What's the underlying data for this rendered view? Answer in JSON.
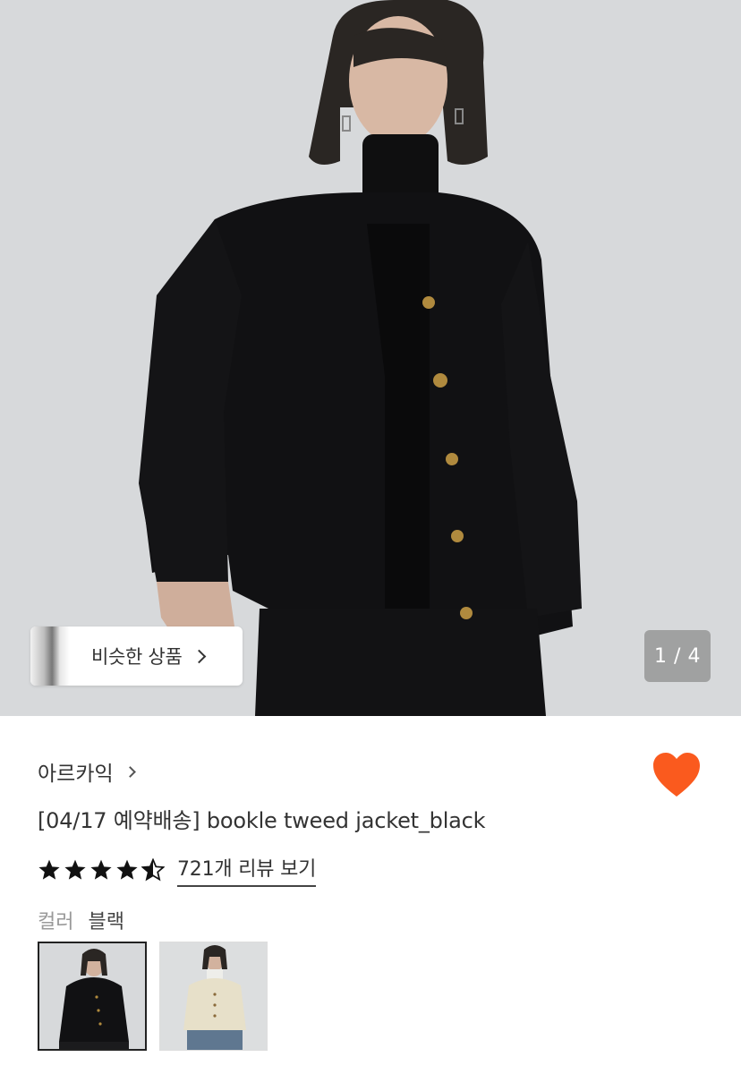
{
  "hero": {
    "similar_label": "비슷한 상품",
    "counter": "1 / 4"
  },
  "product": {
    "brand": "아르카익",
    "title": "[04/17 예약배송] bookle tweed jacket_black",
    "rating": 4.5,
    "review_link": "721개 리뷰 보기",
    "favorited": true
  },
  "color": {
    "label": "컬러",
    "value": "블랙",
    "options": [
      {
        "name": "black",
        "selected": true
      },
      {
        "name": "ivory",
        "selected": false
      }
    ]
  },
  "colors": {
    "heart": "#fa5a1e",
    "star": "#111111",
    "counter_bg": "#969696"
  },
  "icons": [
    "chevron-right-icon",
    "heart-icon",
    "star-icon",
    "star-half-icon"
  ]
}
